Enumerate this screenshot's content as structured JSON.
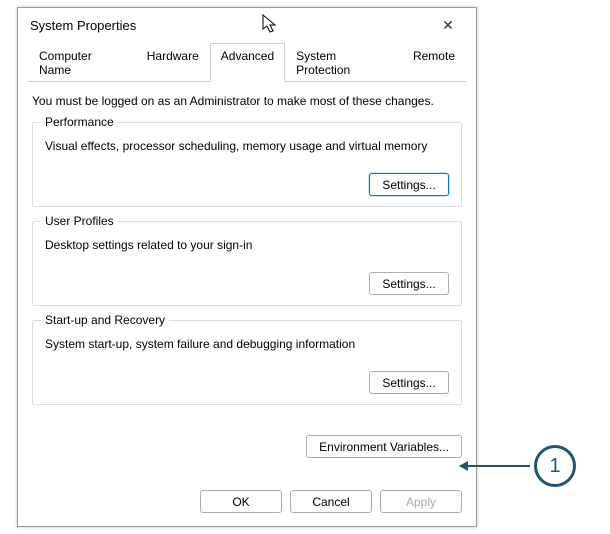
{
  "window": {
    "title": "System Properties",
    "close_glyph": "✕"
  },
  "tabs": {
    "computer_name": "Computer Name",
    "hardware": "Hardware",
    "advanced": "Advanced",
    "system_protection": "System Protection",
    "remote": "Remote"
  },
  "advanced": {
    "notice": "You must be logged on as an Administrator to make most of these changes.",
    "performance": {
      "legend": "Performance",
      "desc": "Visual effects, processor scheduling, memory usage and virtual memory",
      "button": "Settings..."
    },
    "user_profiles": {
      "legend": "User Profiles",
      "desc": "Desktop settings related to your sign-in",
      "button": "Settings..."
    },
    "startup": {
      "legend": "Start-up and Recovery",
      "desc": "System start-up, system failure and debugging information",
      "button": "Settings..."
    },
    "env_button": "Environment Variables..."
  },
  "dialog_buttons": {
    "ok": "OK",
    "cancel": "Cancel",
    "apply": "Apply"
  },
  "annotation": {
    "number": "1"
  }
}
